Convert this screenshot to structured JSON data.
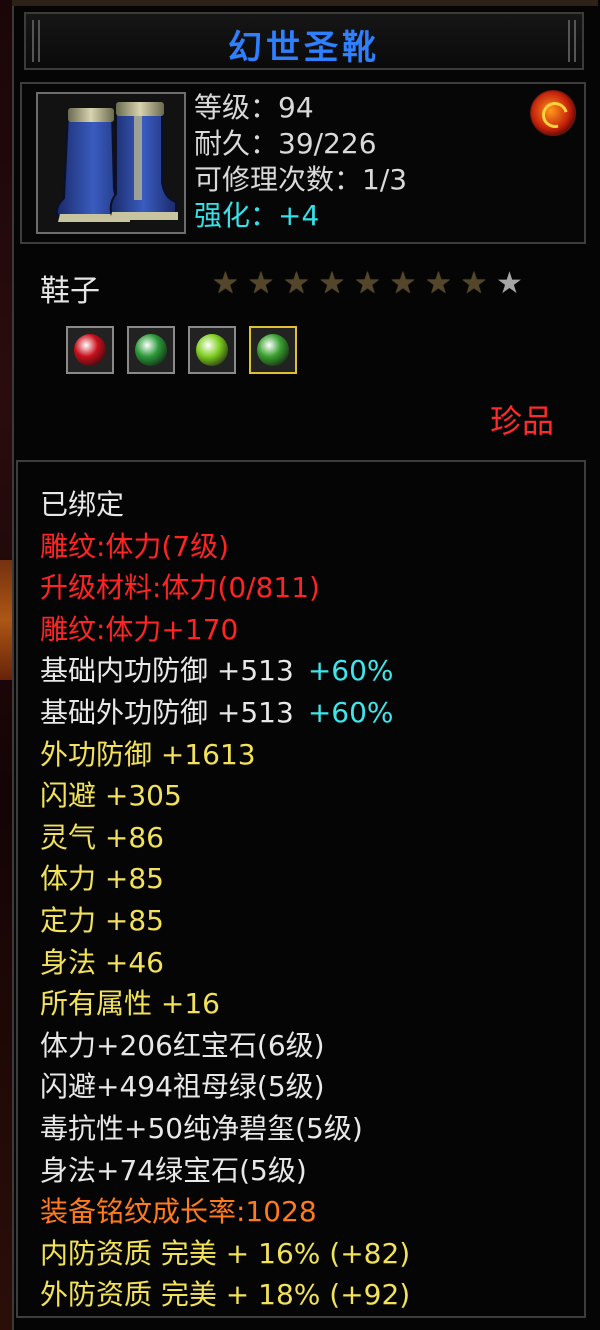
{
  "item": {
    "name": "幻世圣靴",
    "stats": [
      {
        "label": "等级：94",
        "color": "white"
      },
      {
        "label": "耐久：39/226",
        "color": "white"
      },
      {
        "label": "可修理次数：1/3",
        "color": "white"
      },
      {
        "label": "强化：+4",
        "color": "cyan"
      }
    ],
    "type": "鞋子",
    "stars_total": 9,
    "stars_filled": 8,
    "rarity": "珍品",
    "badge_icon": "fire-emblem-icon",
    "gems": [
      {
        "name": "ruby-gem-icon",
        "color": "#c8101c"
      },
      {
        "name": "emerald-gem-icon",
        "color": "#2c9a3a"
      },
      {
        "name": "peridot-gem-icon",
        "color": "#7fcf20"
      },
      {
        "name": "jade-gem-icon",
        "color": "#3aa030"
      }
    ]
  },
  "attributes": [
    {
      "text": "已绑定",
      "color": "white"
    },
    {
      "text": "雕纹:体力(7级)",
      "color": "red"
    },
    {
      "text": "升级材料:体力(0/811)",
      "color": "red"
    },
    {
      "text": "雕纹:体力+170",
      "color": "red"
    },
    {
      "text": "基础内功防御 +513",
      "color": "white",
      "extra": "+60%"
    },
    {
      "text": "基础外功防御 +513",
      "color": "white",
      "extra": "+60%"
    },
    {
      "text": "外功防御 +1613",
      "color": "yellow"
    },
    {
      "text": "闪避 +305",
      "color": "yellow"
    },
    {
      "text": "灵气 +86",
      "color": "yellow"
    },
    {
      "text": "体力 +85",
      "color": "yellow"
    },
    {
      "text": "定力 +85",
      "color": "yellow"
    },
    {
      "text": "身法 +46",
      "color": "yellow"
    },
    {
      "text": "所有属性 +16",
      "color": "yellow"
    },
    {
      "text": "体力+206红宝石(6级)",
      "color": "white"
    },
    {
      "text": "闪避+494祖母绿(5级)",
      "color": "white"
    },
    {
      "text": "毒抗性+50纯净碧玺(5级)",
      "color": "white"
    },
    {
      "text": "身法+74绿宝石(5级)",
      "color": "white"
    },
    {
      "text": "装备铭纹成长率:1028",
      "color": "orange"
    },
    {
      "text": "内防资质 完美 + 16% (+82)",
      "color": "yellow"
    },
    {
      "text": "外防资质 完美 + 18% (+92)",
      "color": "yellow"
    }
  ],
  "colors": {
    "title": "#2f7fff",
    "white": "#e8e8e8",
    "red": "#ff2424",
    "yellow": "#f2e15a",
    "orange": "#ff7a1c",
    "cyan": "#3ee6ec"
  }
}
